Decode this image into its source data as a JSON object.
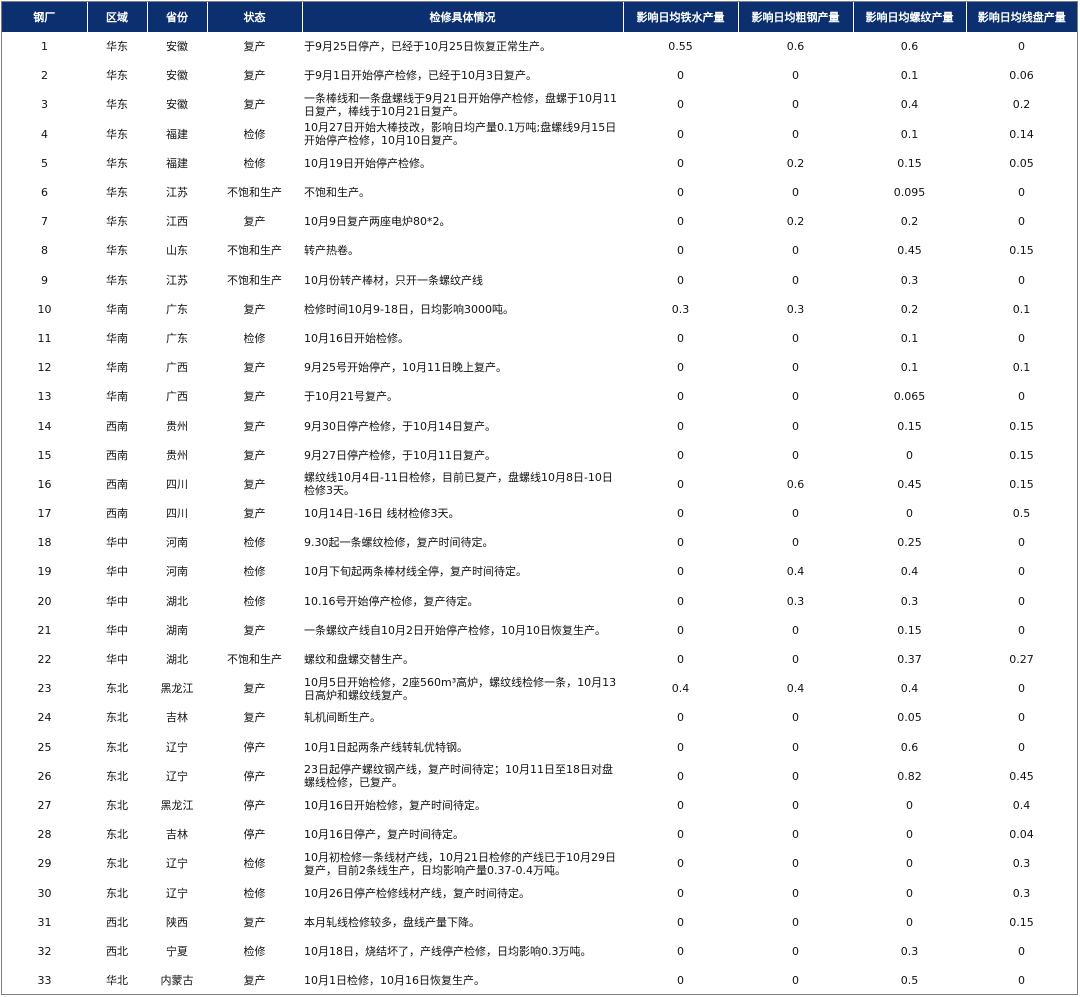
{
  "headers": [
    "钢厂",
    "区域",
    "省份",
    "状态",
    "检修具体情况",
    "影响日均铁水产量",
    "影响日均粗钢产量",
    "影响日均螺纹产量",
    "影响日均线盘产量"
  ],
  "rows": [
    [
      "1",
      "华东",
      "安徽",
      "复产",
      "于9月25日停产，已经于10月25日恢复正常生产。",
      "0.55",
      "0.6",
      "0.6",
      "0"
    ],
    [
      "2",
      "华东",
      "安徽",
      "复产",
      "于9月1日开始停产检修，已经于10月3日复产。",
      "0",
      "0",
      "0.1",
      "0.06"
    ],
    [
      "3",
      "华东",
      "安徽",
      "复产",
      "一条棒线和一条盘螺线于9月21日开始停产检修，盘螺于10月11日复产，棒线于10月21日复产。",
      "0",
      "0",
      "0.4",
      "0.2"
    ],
    [
      "4",
      "华东",
      "福建",
      "检修",
      "10月27日开始大棒技改，影响日均产量0.1万吨;盘螺线9月15日开始停产检修，10月10日复产。",
      "0",
      "0",
      "0.1",
      "0.14"
    ],
    [
      "5",
      "华东",
      "福建",
      "检修",
      "10月19日开始停产检修。",
      "0",
      "0.2",
      "0.15",
      "0.05"
    ],
    [
      "6",
      "华东",
      "江苏",
      "不饱和生产",
      "不饱和生产。",
      "0",
      "0",
      "0.095",
      "0"
    ],
    [
      "7",
      "华东",
      "江西",
      "复产",
      "10月9日复产两座电炉80*2。",
      "0",
      "0.2",
      "0.2",
      "0"
    ],
    [
      "8",
      "华东",
      "山东",
      "不饱和生产",
      "转产热卷。",
      "0",
      "0",
      "0.45",
      "0.15"
    ],
    [
      "9",
      "华东",
      "江苏",
      "不饱和生产",
      "10月份转产棒材，只开一条螺纹产线",
      "0",
      "0",
      "0.3",
      "0"
    ],
    [
      "10",
      "华南",
      "广东",
      "复产",
      "检修时间10月9-18日，日均影响3000吨。",
      "0.3",
      "0.3",
      "0.2",
      "0.1"
    ],
    [
      "11",
      "华南",
      "广东",
      "检修",
      "10月16日开始检修。",
      "0",
      "0",
      "0.1",
      "0"
    ],
    [
      "12",
      "华南",
      "广西",
      "复产",
      "9月25号开始停产，10月11日晚上复产。",
      "0",
      "0",
      "0.1",
      "0.1"
    ],
    [
      "13",
      "华南",
      "广西",
      "复产",
      "于10月21号复产。",
      "0",
      "0",
      "0.065",
      "0"
    ],
    [
      "14",
      "西南",
      "贵州",
      "复产",
      "9月30日停产检修，于10月14日复产。",
      "0",
      "0",
      "0.15",
      "0.15"
    ],
    [
      "15",
      "西南",
      "贵州",
      "复产",
      "9月27日停产检修，于10月11日复产。",
      "0",
      "0",
      "0",
      "0.15"
    ],
    [
      "16",
      "西南",
      "四川",
      "复产",
      "螺纹线10月4日-11日检修，目前已复产，盘螺线10月8日-10日检修3天。",
      "0",
      "0.6",
      "0.45",
      "0.15"
    ],
    [
      "17",
      "西南",
      "四川",
      "复产",
      "10月14日-16日 线材检修3天。",
      "0",
      "0",
      "0",
      "0.5"
    ],
    [
      "18",
      "华中",
      "河南",
      "检修",
      "9.30起一条螺纹检修，复产时间待定。",
      "0",
      "0",
      "0.25",
      "0"
    ],
    [
      "19",
      "华中",
      "河南",
      "检修",
      "10月下旬起两条棒材线全停，复产时间待定。",
      "0",
      "0.4",
      "0.4",
      "0"
    ],
    [
      "20",
      "华中",
      "湖北",
      "检修",
      "10.16号开始停产检修，复产待定。",
      "0",
      "0.3",
      "0.3",
      "0"
    ],
    [
      "21",
      "华中",
      "湖南",
      "复产",
      "一条螺纹产线自10月2日开始停产检修，10月10日恢复生产。",
      "0",
      "0",
      "0.15",
      "0"
    ],
    [
      "22",
      "华中",
      "湖北",
      "不饱和生产",
      "螺纹和盘螺交替生产。",
      "0",
      "0",
      "0.37",
      "0.27"
    ],
    [
      "23",
      "东北",
      "黑龙江",
      "复产",
      "10月5日开始检修，2座560m³高炉，螺纹线检修一条，10月13日高炉和螺纹线复产。",
      "0.4",
      "0.4",
      "0.4",
      "0"
    ],
    [
      "24",
      "东北",
      "吉林",
      "复产",
      "轧机间断生产。",
      "0",
      "0",
      "0.05",
      "0"
    ],
    [
      "25",
      "东北",
      "辽宁",
      "停产",
      "10月1日起两条产线转轧优特钢。",
      "0",
      "0",
      "0.6",
      "0"
    ],
    [
      "26",
      "东北",
      "辽宁",
      "停产",
      "23日起停产螺纹钢产线，复产时间待定；10月11日至18日对盘螺线检修，已复产。",
      "0",
      "0",
      "0.82",
      "0.45"
    ],
    [
      "27",
      "东北",
      "黑龙江",
      "停产",
      "10月16日开始检修，复产时间待定。",
      "0",
      "0",
      "0",
      "0.4"
    ],
    [
      "28",
      "东北",
      "吉林",
      "停产",
      "10月16日停产，复产时间待定。",
      "0",
      "0",
      "0",
      "0.04"
    ],
    [
      "29",
      "东北",
      "辽宁",
      "检修",
      "10月初检修一条线材产线，10月21日检修的产线已于10月29日复产，目前2条线生产，日均影响产量0.37-0.4万吨。",
      "0",
      "0",
      "0",
      "0.3"
    ],
    [
      "30",
      "东北",
      "辽宁",
      "检修",
      "10月26日停产检修线材产线，复产时间待定。",
      "0",
      "0",
      "0",
      "0.3"
    ],
    [
      "31",
      "西北",
      "陕西",
      "复产",
      "本月轧线检修较多，盘线产量下降。",
      "0",
      "0",
      "0",
      "0.15"
    ],
    [
      "32",
      "西北",
      "宁夏",
      "检修",
      "10月18日，烧结坏了，产线停产检修，日均影响0.3万吨。",
      "0",
      "0",
      "0.3",
      "0"
    ],
    [
      "33",
      "华北",
      "内蒙古",
      "复产",
      "10月1日检修，10月16日恢复生产。",
      "0",
      "0",
      "0.5",
      "0"
    ]
  ]
}
